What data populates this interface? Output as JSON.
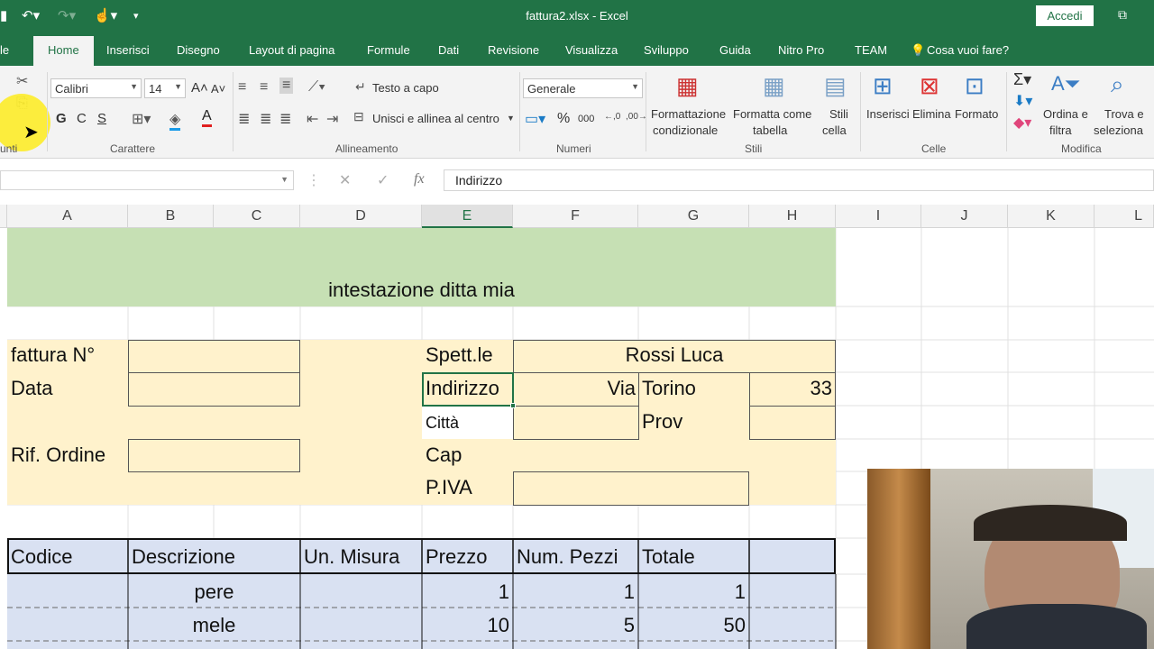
{
  "titlebar": {
    "filename": "fattura2.xlsx - Excel",
    "signin": "Accedi"
  },
  "tabs": [
    "le",
    "Home",
    "Inserisci",
    "Disegno",
    "Layout di pagina",
    "Formule",
    "Dati",
    "Revisione",
    "Visualizza",
    "Sviluppo",
    "Guida",
    "Nitro Pro",
    "TEAM",
    "Cosa vuoi fare?"
  ],
  "ribbon": {
    "font_name": "Calibri",
    "font_size": "14",
    "bold": "G",
    "italic": "C",
    "underline": "S",
    "wrap": "Testo a capo",
    "merge": "Unisci e allinea al centro",
    "number_format": "Generale",
    "percent": "%",
    "thousands": "000",
    "cond_format": [
      "Formattazione",
      "condizionale"
    ],
    "format_table": [
      "Formatta come",
      "tabella"
    ],
    "cell_styles": [
      "Stili",
      "cella"
    ],
    "insert": "Inserisci",
    "delete": "Elimina",
    "format": "Formato",
    "sort": [
      "Ordina e",
      "filtra"
    ],
    "find": [
      "Trova e",
      "seleziona"
    ],
    "groups": {
      "clipboard": "unti",
      "font": "Carattere",
      "alignment": "Allineamento",
      "number": "Numeri",
      "styles": "Stili",
      "cells": "Celle",
      "editing": "Modifica"
    }
  },
  "formula_bar": {
    "fx": "fx",
    "content": "Indirizzo"
  },
  "columns": [
    "A",
    "B",
    "C",
    "D",
    "E",
    "F",
    "G",
    "H",
    "I",
    "J",
    "K",
    "L"
  ],
  "sheet": {
    "header_title": "intestazione ditta mia",
    "invoice_no": "fattura N°",
    "date": "Data",
    "order_ref": "Rif. Ordine",
    "to": "Spett.le",
    "client": "Rossi Luca",
    "address": "Indirizzo",
    "street_type": "Via",
    "street_name": "Torino",
    "street_no": "33",
    "city": "Città",
    "province": "Prov",
    "zip": "Cap",
    "vat": "P.IVA",
    "table_headers": [
      "Codice",
      "Descrizione",
      "Un. Misura",
      "Prezzo",
      "Num. Pezzi",
      "Totale"
    ],
    "rows": [
      {
        "desc": "pere",
        "price": "1",
        "qty": "1",
        "total": "1"
      },
      {
        "desc": "mele",
        "price": "10",
        "qty": "5",
        "total": "50"
      }
    ]
  },
  "colors": {
    "excel_green": "#217346",
    "header_fill": "#c6e0b4",
    "info_fill": "#fff2cc",
    "table_fill": "#d9e1f2"
  }
}
